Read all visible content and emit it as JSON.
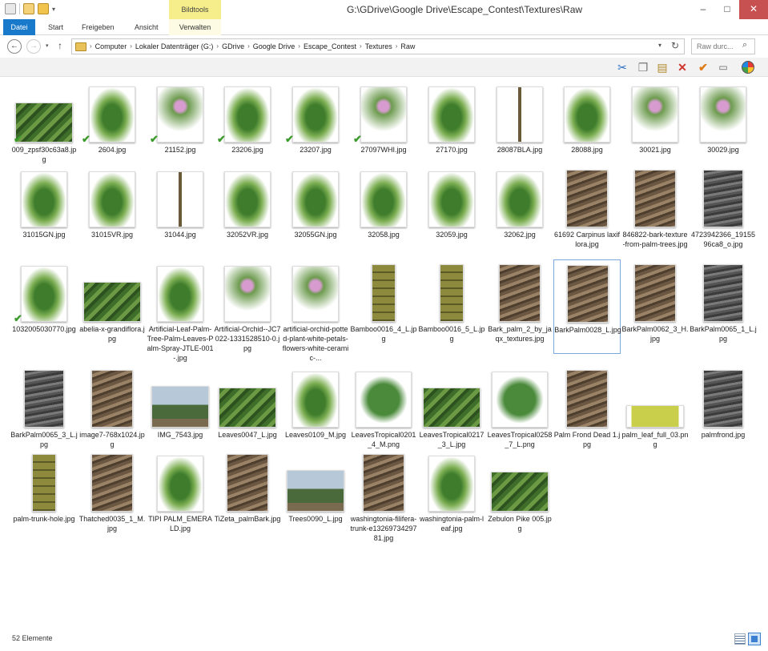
{
  "window": {
    "title": "G:\\GDrive\\Google Drive\\Escape_Contest\\Textures\\Raw",
    "context_tab_group": "Bildtools",
    "minimize": "–",
    "maximize": "□",
    "close": "✕"
  },
  "ribbon": {
    "tabs": [
      "Datei",
      "Start",
      "Freigeben",
      "Ansicht",
      "Verwalten"
    ]
  },
  "address": {
    "crumbs": [
      "Computer",
      "Lokaler Datenträger (G:)",
      "GDrive",
      "Google Drive",
      "Escape_Contest",
      "Textures",
      "Raw"
    ],
    "search_placeholder": "Raw durc..."
  },
  "status": {
    "count": "52 Elemente"
  },
  "colors": {
    "accent": "#1979ca",
    "selection_border": "#7aa9e0",
    "close_button": "#c75050",
    "bildtools": "#f5ee8a"
  },
  "files": [
    {
      "name": "009_zpsf30c63a8.jpg",
      "checked": true,
      "kind": "green"
    },
    {
      "name": "2604.jpg",
      "checked": true,
      "kind": "plant"
    },
    {
      "name": "21152.jpg",
      "checked": true,
      "kind": "flower"
    },
    {
      "name": "23206.jpg",
      "checked": true,
      "kind": "plant"
    },
    {
      "name": "23207.jpg",
      "checked": true,
      "kind": "plant"
    },
    {
      "name": "27097WHI.jpg",
      "checked": true,
      "kind": "flower"
    },
    {
      "name": "27170.jpg",
      "checked": false,
      "kind": "plant"
    },
    {
      "name": "28087BLA.jpg",
      "checked": false,
      "kind": "stick"
    },
    {
      "name": "28088.jpg",
      "checked": false,
      "kind": "plant"
    },
    {
      "name": "30021.jpg",
      "checked": false,
      "kind": "flower"
    },
    {
      "name": "30029.jpg",
      "checked": false,
      "kind": "flower"
    },
    {
      "name": "31015GN.jpg",
      "checked": false,
      "kind": "plant"
    },
    {
      "name": "31015VR.jpg",
      "checked": false,
      "kind": "plant"
    },
    {
      "name": "31044.jpg",
      "checked": false,
      "kind": "stick"
    },
    {
      "name": "32052VR.jpg",
      "checked": false,
      "kind": "plant"
    },
    {
      "name": "32055GN.jpg",
      "checked": false,
      "kind": "plant"
    },
    {
      "name": "32058.jpg",
      "checked": false,
      "kind": "plant"
    },
    {
      "name": "32059.jpg",
      "checked": false,
      "kind": "plant"
    },
    {
      "name": "32062.jpg",
      "checked": false,
      "kind": "plant"
    },
    {
      "name": "61692 Carpinus laxiflora.jpg",
      "checked": false,
      "kind": "bark"
    },
    {
      "name": "846822-bark-texture-from-palm-trees.jpg",
      "checked": false,
      "kind": "bark"
    },
    {
      "name": "4723942366_1915596ca8_o.jpg",
      "checked": false,
      "kind": "dark"
    },
    {
      "name": "1032005030770.jpg",
      "checked": true,
      "kind": "plant"
    },
    {
      "name": "abelia-x-grandiflora.jpg",
      "checked": false,
      "kind": "green"
    },
    {
      "name": "Artificial-Leaf-Palm-Tree-Palm-Leaves-Palm-Spray-JTLE-001-.jpg",
      "checked": false,
      "kind": "plant"
    },
    {
      "name": "Artificial-Orchid--JC7022-1331528510-0.jpg",
      "checked": false,
      "kind": "flower"
    },
    {
      "name": "artificial-orchid-potted-plant-white-petals-flowers-white-ceramic-...",
      "checked": false,
      "kind": "flower"
    },
    {
      "name": "Bamboo0016_4_L.jpg",
      "checked": false,
      "kind": "trunk"
    },
    {
      "name": "Bamboo0016_5_L.jpg",
      "checked": false,
      "kind": "trunk"
    },
    {
      "name": "Bark_palm_2_by_jaqx_textures.jpg",
      "checked": false,
      "kind": "bark"
    },
    {
      "name": "BarkPalm0028_L.jpg",
      "checked": false,
      "kind": "bark"
    },
    {
      "name": "BarkPalm0062_3_H.jpg",
      "checked": false,
      "kind": "bark"
    },
    {
      "name": "BarkPalm0065_1_L.jpg",
      "checked": false,
      "kind": "dark"
    },
    {
      "name": "BarkPalm0065_3_L.jpg",
      "checked": false,
      "kind": "dark"
    },
    {
      "name": "image7-768x1024.jpg",
      "checked": false,
      "kind": "bark"
    },
    {
      "name": "IMG_7543.jpg",
      "checked": false,
      "kind": "sky"
    },
    {
      "name": "Leaves0047_L.jpg",
      "checked": false,
      "kind": "green"
    },
    {
      "name": "Leaves0109_M.jpg",
      "checked": false,
      "kind": "plant"
    },
    {
      "name": "LeavesTropical0201_4_M.png",
      "checked": false,
      "kind": "leaf"
    },
    {
      "name": "LeavesTropical0217_3_L.jpg",
      "checked": false,
      "kind": "green"
    },
    {
      "name": "LeavesTropical0258_7_L.png",
      "checked": false,
      "kind": "leaf"
    },
    {
      "name": "Palm Frond Dead 1.jpg",
      "checked": false,
      "kind": "bark"
    },
    {
      "name": "palm_leaf_full_03.png",
      "checked": false,
      "kind": "yellow"
    },
    {
      "name": "palmfrond.jpg",
      "checked": false,
      "kind": "dark"
    },
    {
      "name": "palm-trunk-hole.jpg",
      "checked": false,
      "kind": "trunk"
    },
    {
      "name": "Thatched0035_1_M.jpg",
      "checked": false,
      "kind": "bark"
    },
    {
      "name": "TIPI PALM_EMERALD.jpg",
      "checked": false,
      "kind": "plant"
    },
    {
      "name": "TiZeta_palmBark.jpg",
      "checked": false,
      "kind": "bark"
    },
    {
      "name": "Trees0090_L.jpg",
      "checked": false,
      "kind": "sky"
    },
    {
      "name": "washingtonia-filifera-trunk-e1326973429781.jpg",
      "checked": false,
      "kind": "bark"
    },
    {
      "name": "washingtonia-palm-leaf.jpg",
      "checked": false,
      "kind": "plant"
    },
    {
      "name": "Zebulon Pike 005.jpg",
      "checked": false,
      "kind": "green"
    }
  ]
}
